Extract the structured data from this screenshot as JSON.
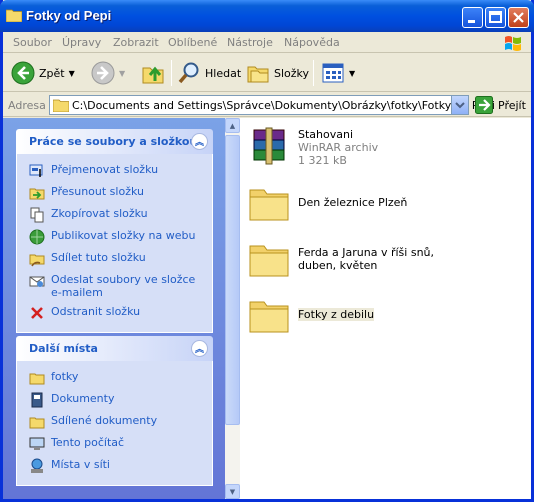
{
  "window": {
    "title": "Fotky od Pepi"
  },
  "menubar": {
    "items": [
      "Soubor",
      "Úpravy",
      "Zobrazit",
      "Oblíbené",
      "Nástroje",
      "Nápověda"
    ]
  },
  "toolbar": {
    "back": "Zpět",
    "search": "Hledat",
    "folders": "Složky"
  },
  "address": {
    "label": "Adresa",
    "path": "C:\\Documents and Settings\\Správce\\Dokumenty\\Obrázky\\fotky\\Fotky od Pepi",
    "go": "Přejít"
  },
  "tasks_panel": {
    "title": "Práce se soubory a složkou",
    "items": [
      {
        "label": "Přejmenovat složku",
        "icon": "rename-icon"
      },
      {
        "label": "Přesunout složku",
        "icon": "move-folder-icon"
      },
      {
        "label": "Zkopírovat složku",
        "icon": "copy-icon"
      },
      {
        "label": "Publikovat složky na webu",
        "icon": "publish-web-icon"
      },
      {
        "label": "Sdílet tuto složku",
        "icon": "share-folder-icon"
      },
      {
        "label": "Odeslat soubory ve složce e-mailem",
        "icon": "email-icon"
      },
      {
        "label": "Odstranit složku",
        "icon": "delete-icon"
      }
    ]
  },
  "places_panel": {
    "title": "Další místa",
    "items": [
      {
        "label": "fotky",
        "icon": "folder-icon"
      },
      {
        "label": "Dokumenty",
        "icon": "documents-icon"
      },
      {
        "label": "Sdílené dokumenty",
        "icon": "shared-documents-icon"
      },
      {
        "label": "Tento počítač",
        "icon": "computer-icon"
      },
      {
        "label": "Místa v síti",
        "icon": "network-icon"
      }
    ]
  },
  "files": [
    {
      "name": "Stahovani",
      "type": "WinRAR archiv",
      "size": "1 321 kB",
      "icon": "winrar-icon"
    },
    {
      "name": "Den železnice Plzeň",
      "icon": "folder-icon"
    },
    {
      "name": "Ferda a Jaruna v říši snů, duben, květen",
      "icon": "folder-icon"
    },
    {
      "name": "Fotky z debilu",
      "icon": "folder-icon"
    }
  ],
  "colors": {
    "title_bar": "#0050e0",
    "task_link": "#215dc6",
    "pane_bg": "#6f8fe0"
  }
}
